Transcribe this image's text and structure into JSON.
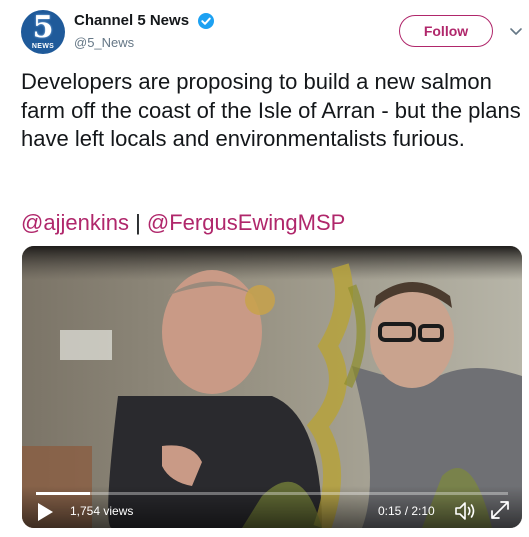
{
  "account": {
    "avatar_number": "5",
    "avatar_text": "NEWS",
    "display_name": "Channel 5 News",
    "handle": "@5_News",
    "verified": true
  },
  "follow_button": {
    "label": "Follow"
  },
  "tweet": {
    "text": "Developers are proposing to build a new salmon farm off the coast of the Isle of Arran - but the plans have left locals and environmentalists furious.",
    "mentions": [
      "@ajjenkins",
      "@FergusEwingMSP"
    ],
    "separator": "|"
  },
  "video": {
    "views": "1,754 views",
    "time": "0:15 / 2:10",
    "progress": 0.115
  },
  "colors": {
    "accent": "#b0276b",
    "verified": "#1da1f2",
    "text": "#14171a",
    "muted": "#657786"
  },
  "icons": [
    "verified-icon",
    "chevron-down-icon",
    "play-icon",
    "volume-icon",
    "fullscreen-icon"
  ]
}
